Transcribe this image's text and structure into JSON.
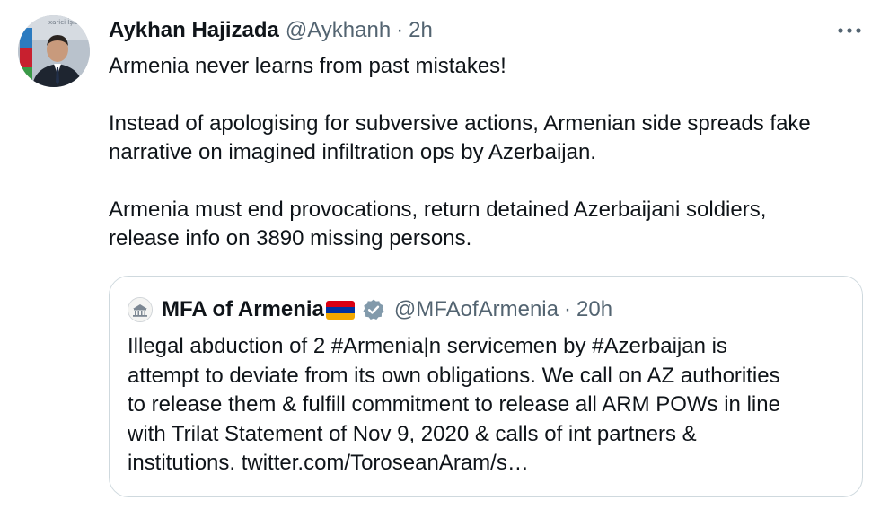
{
  "author": {
    "name": "Aykhan Hajizada",
    "handle": "@Aykhanh",
    "separator": "·",
    "time": "2h",
    "avatar_icon": "profile-photo-avatar"
  },
  "more_icon": "more-horizontal-icon",
  "tweet": {
    "paragraphs": [
      "Armenia never learns from past mistakes!",
      "Instead of apologising for subversive actions, Armenian side spreads fake\nnarrative on imagined infiltration ops by Azerbaijan.",
      "Armenia must end provocations, return detained Azerbaijani soldiers,\nrelease info on 3890 missing persons."
    ]
  },
  "quote": {
    "name": "MFA of Armenia",
    "flag_icon": "armenia-flag-icon",
    "flag_colors": [
      "#d90012",
      "#0033a0",
      "#f2a800"
    ],
    "verified_icon": "verified-badge-icon",
    "verified_color": "#829aab",
    "handle": "@MFAofArmenia",
    "separator": "·",
    "time": "20h",
    "text": "Illegal abduction of 2 #Armenia|n servicemen by #Azerbaijan is\nattempt to deviate from its own obligations. We call on AZ authorities\nto release them & fulfill commitment to release all ARM POWs in line\nwith Trilat Statement of Nov 9, 2020 & calls of int partners &\ninstitutions. twitter.com/ToroseanAram/s…"
  }
}
